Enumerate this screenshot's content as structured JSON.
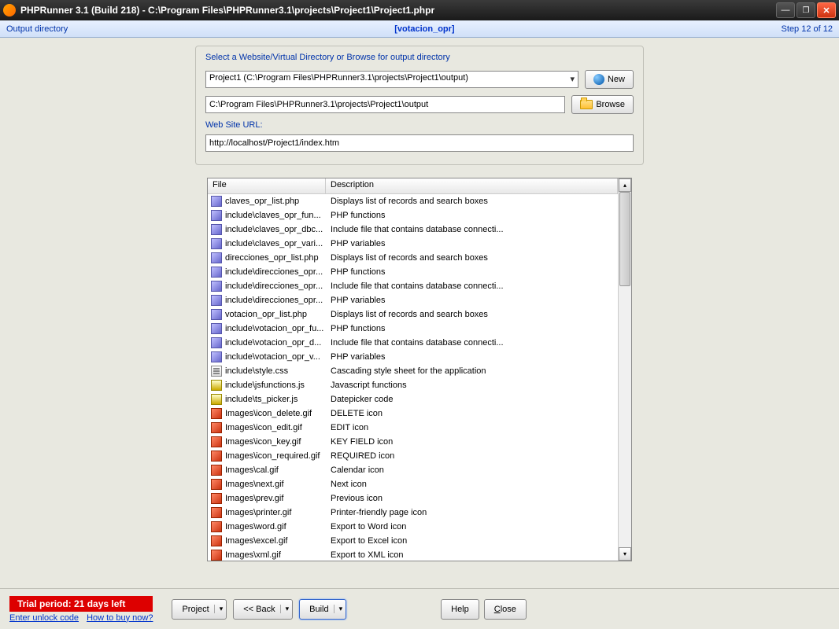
{
  "window": {
    "title": "PHPRunner 3.1 (Build 218) - C:\\Program Files\\PHPRunner3.1\\projects\\Project1\\Project1.phpr"
  },
  "subbar": {
    "left": "Output directory",
    "center": "[votacion_opr]",
    "right": "Step 12 of 12"
  },
  "panel": {
    "instruction": "Select a Website/Virtual Directory or Browse for output directory",
    "combo_value": "Project1 (C:\\Program Files\\PHPRunner3.1\\projects\\Project1\\output)",
    "path_value": "C:\\Program Files\\PHPRunner3.1\\projects\\Project1\\output",
    "new_label": "New",
    "browse_label": "Browse",
    "url_label": "Web Site URL:",
    "url_value": "http://localhost/Project1/index.htm"
  },
  "filelist": {
    "col_file": "File",
    "col_desc": "Description",
    "rows": [
      {
        "icon": "php",
        "file": "claves_opr_list.php",
        "desc": "Displays list of records and search boxes"
      },
      {
        "icon": "php",
        "file": "include\\claves_opr_fun...",
        "desc": "PHP functions"
      },
      {
        "icon": "php",
        "file": "include\\claves_opr_dbc...",
        "desc": "Include file that contains database connecti..."
      },
      {
        "icon": "php",
        "file": "include\\claves_opr_vari...",
        "desc": "PHP variables"
      },
      {
        "icon": "php",
        "file": "direcciones_opr_list.php",
        "desc": "Displays list of records and search boxes"
      },
      {
        "icon": "php",
        "file": "include\\direcciones_opr...",
        "desc": "PHP functions"
      },
      {
        "icon": "php",
        "file": "include\\direcciones_opr...",
        "desc": "Include file that contains database connecti..."
      },
      {
        "icon": "php",
        "file": "include\\direcciones_opr...",
        "desc": "PHP variables"
      },
      {
        "icon": "php",
        "file": "votacion_opr_list.php",
        "desc": "Displays list of records and search boxes"
      },
      {
        "icon": "php",
        "file": "include\\votacion_opr_fu...",
        "desc": "PHP functions"
      },
      {
        "icon": "php",
        "file": "include\\votacion_opr_d...",
        "desc": "Include file that contains database connecti..."
      },
      {
        "icon": "php",
        "file": "include\\votacion_opr_v...",
        "desc": "PHP variables"
      },
      {
        "icon": "css",
        "file": "include\\style.css",
        "desc": "Cascading style sheet for the application"
      },
      {
        "icon": "js",
        "file": "include\\jsfunctions.js",
        "desc": "Javascript functions"
      },
      {
        "icon": "js",
        "file": "include\\ts_picker.js",
        "desc": "Datepicker code"
      },
      {
        "icon": "img",
        "file": "Images\\icon_delete.gif",
        "desc": "DELETE icon"
      },
      {
        "icon": "img",
        "file": "Images\\icon_edit.gif",
        "desc": "EDIT icon"
      },
      {
        "icon": "img",
        "file": "Images\\icon_key.gif",
        "desc": "KEY FIELD icon"
      },
      {
        "icon": "img",
        "file": "Images\\icon_required.gif",
        "desc": "REQUIRED icon"
      },
      {
        "icon": "img",
        "file": "Images\\cal.gif",
        "desc": "Calendar icon"
      },
      {
        "icon": "img",
        "file": "Images\\next.gif",
        "desc": "Next icon"
      },
      {
        "icon": "img",
        "file": "Images\\prev.gif",
        "desc": "Previous icon"
      },
      {
        "icon": "img",
        "file": "Images\\printer.gif",
        "desc": "Printer-friendly page icon"
      },
      {
        "icon": "img",
        "file": "Images\\word.gif",
        "desc": "Export to Word icon"
      },
      {
        "icon": "img",
        "file": "Images\\excel.gif",
        "desc": "Export to Excel icon"
      },
      {
        "icon": "img",
        "file": "Images\\xml.gif",
        "desc": "Export to XML icon"
      }
    ]
  },
  "bottom": {
    "trial_banner": "Trial period: 21 days left",
    "unlock_link": "Enter unlock code",
    "buy_link": "How to buy now?",
    "project_btn": "Project",
    "back_btn": "<< Back",
    "build_btn": "Build",
    "help_btn": "Help",
    "close_btn": "Close"
  }
}
